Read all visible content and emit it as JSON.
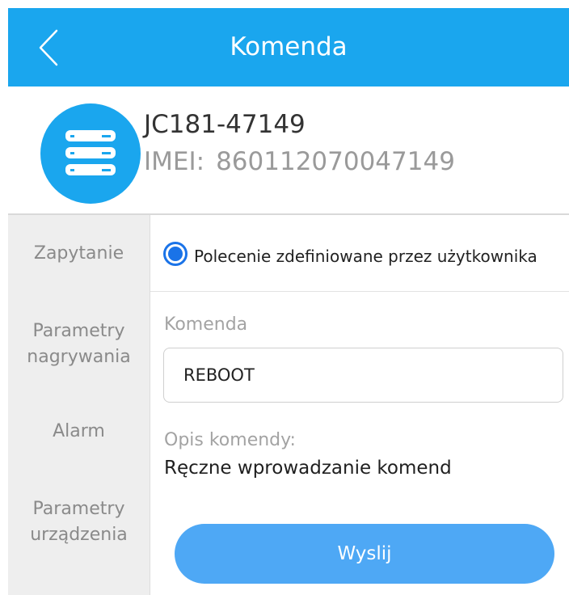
{
  "header": {
    "title": "Komenda",
    "back_icon": "chevron-left-icon",
    "background_color": "#1aa6ee"
  },
  "device": {
    "icon": "server-icon",
    "name": "JC181-47149",
    "imei_label": "IMEI:",
    "imei_value": "860112070047149"
  },
  "sidebar": {
    "items": [
      {
        "line1": "Zapytanie",
        "line2": ""
      },
      {
        "line1": "Parametry",
        "line2": "nagrywania"
      },
      {
        "line1": "Alarm",
        "line2": ""
      },
      {
        "line1": "Parametry",
        "line2": "urządzenia"
      }
    ]
  },
  "main": {
    "radio_label": "Polecenie zdefiniowane przez użytkownika",
    "radio_selected": true,
    "command_label": "Komenda",
    "command_value": "REBOOT",
    "description_label": "Opis komendy:",
    "description_text": "Ręczne wprowadzanie komend",
    "send_button_label": "Wyslij",
    "accent_color": "#1a73e8",
    "button_color": "#4ea8f5"
  }
}
